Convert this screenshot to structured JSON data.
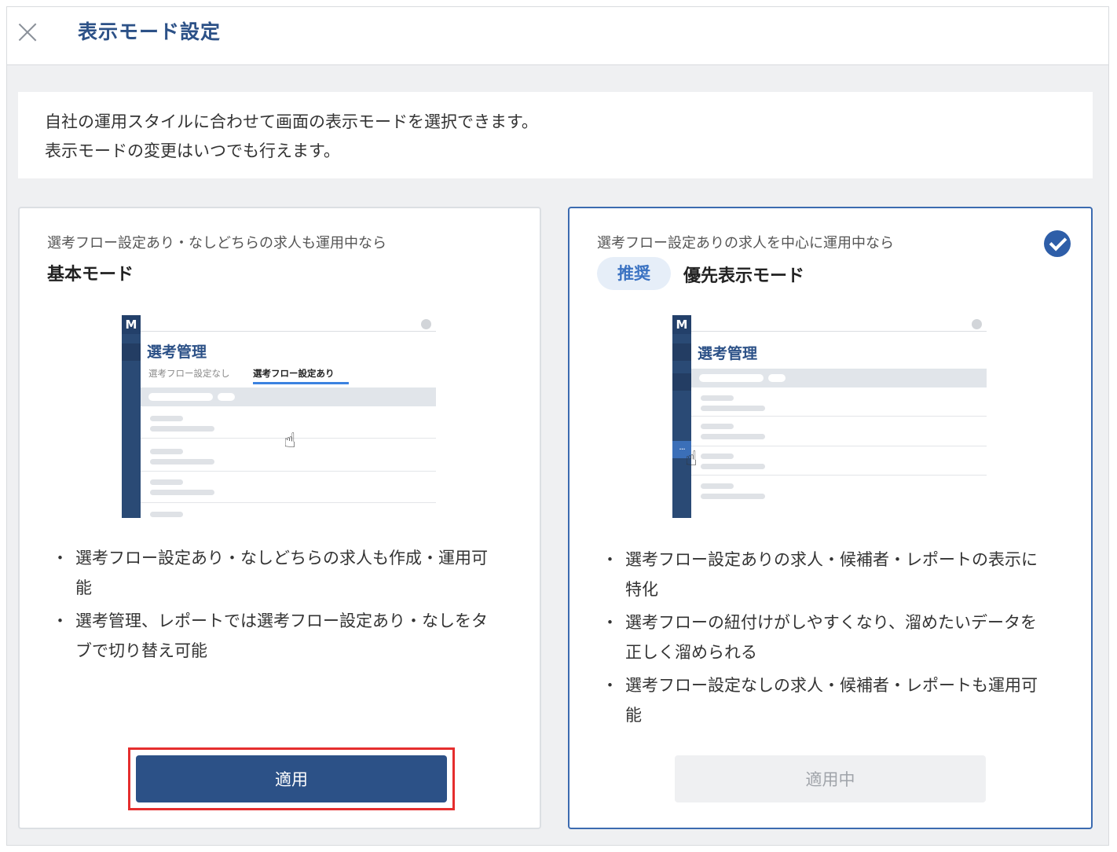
{
  "modal": {
    "title": "表示モード設定",
    "description_lines": [
      "自社の運用スタイルに合わせて画面の表示モードを選択できます。",
      "表示モードの変更はいつでも行えます。"
    ]
  },
  "cards": {
    "basic": {
      "subtitle": "選考フロー設定あり・なしどちらの求人も運用中なら",
      "name": "基本モード",
      "illustration": {
        "logo": "M",
        "title": "選考管理",
        "tab_off": "選考フロー設定なし",
        "tab_on": "選考フロー設定あり"
      },
      "bullets": [
        "選考フロー設定あり・なしどちらの求人も作成・運用可能",
        "選考管理、レポートでは選考フロー設定あり・なしをタブで切り替え可能"
      ],
      "button": "適用",
      "selected": false
    },
    "priority": {
      "subtitle": "選考フロー設定ありの求人を中心に運用中なら",
      "badge": "推奨",
      "name": "優先表示モード",
      "illustration": {
        "logo": "M",
        "title": "選考管理",
        "menu_glyph": "..."
      },
      "bullets": [
        "選考フロー設定ありの求人・候補者・レポートの表示に特化",
        "選考フローの紐付けがしやすくなり、溜めたいデータを正しく溜められる",
        "選考フロー設定なしの求人・候補者・レポートも運用可能"
      ],
      "button": "適用中",
      "selected": true
    }
  },
  "icons": {
    "close": "close-icon",
    "check": "check-circle-icon",
    "cursor": "hand-pointer-icon"
  },
  "colors": {
    "primary": "#2c5187",
    "selected_border": "#3c6bb0",
    "highlight_frame": "#e52e2e",
    "badge_bg": "#e6eef8",
    "badge_text": "#3a72c2"
  }
}
